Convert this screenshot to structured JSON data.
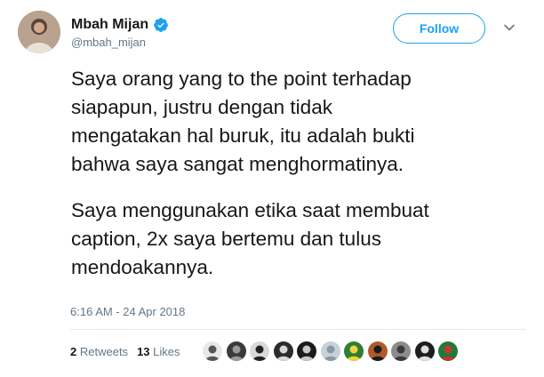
{
  "user": {
    "display_name": "Mbah Mijan",
    "handle": "@mbah_mijan",
    "verified": true
  },
  "follow_label": "Follow",
  "tweet": {
    "paragraphs": [
      "Saya orang yang to the point terhadap\nsiapapun, justru dengan tidak\nmengatakan hal buruk, itu adalah bukti\nbahwa saya sangat menghormatinya.",
      "Saya menggunakan etika saat membuat\ncaption, 2x saya bertemu dan tulus\nmendoakannya."
    ],
    "timestamp": "6:16 AM - 24 Apr 2018"
  },
  "stats": {
    "retweets_count": "2",
    "retweets_label": "Retweets",
    "likes_count": "13",
    "likes_label": "Likes"
  },
  "colors": {
    "accent": "#1da1f2",
    "text": "#14171a",
    "muted": "#657786"
  },
  "liker_avatars": [
    {
      "bg": "#e8e8e8",
      "fg": "#555555"
    },
    {
      "bg": "#3a3a3a",
      "fg": "#9a9a9a"
    },
    {
      "bg": "#d9d9d9",
      "fg": "#222222"
    },
    {
      "bg": "#2b2b2b",
      "fg": "#d8d8d8"
    },
    {
      "bg": "#1a1a1a",
      "fg": "#c8c8c8"
    },
    {
      "bg": "#c8d1d8",
      "fg": "#8899a6"
    },
    {
      "bg": "#2f7d32",
      "fg": "#f2d33b"
    },
    {
      "bg": "#b05a2b",
      "fg": "#1b1b1b"
    },
    {
      "bg": "#8c8c8c",
      "fg": "#3a3a3a"
    },
    {
      "bg": "#1e1e1e",
      "fg": "#e0e0e0"
    },
    {
      "bg": "#1f7a3a",
      "fg": "#c0392b"
    }
  ]
}
